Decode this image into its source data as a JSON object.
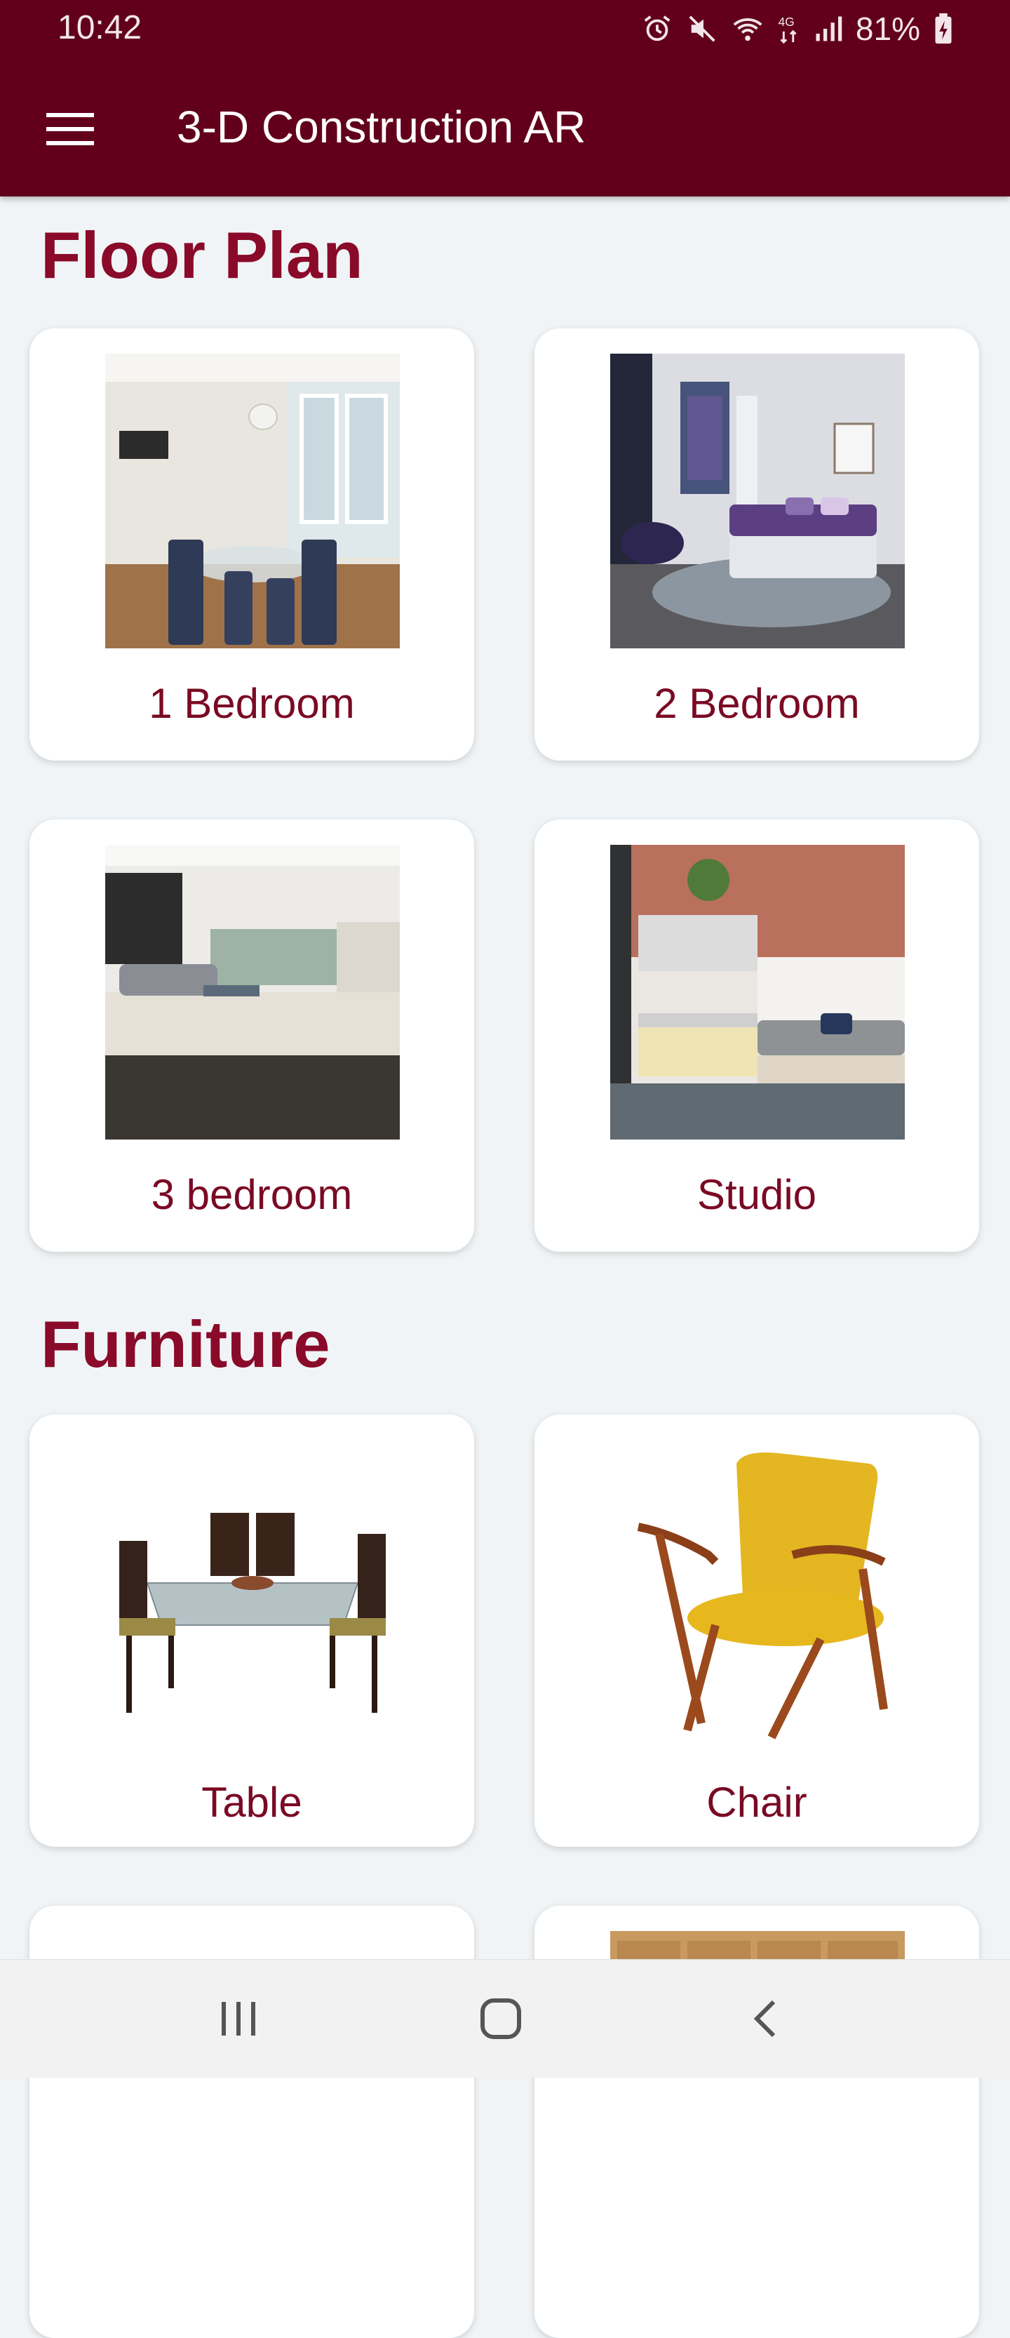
{
  "status_bar": {
    "time": "10:42",
    "battery": "81%",
    "icons": [
      "alarm-icon",
      "mute-icon",
      "wifi-icon",
      "4g-icon",
      "signal-icon",
      "battery-charging-icon"
    ]
  },
  "app_bar": {
    "title": "3-D Construction AR",
    "menu_icon": "hamburger-menu-icon",
    "background": "#62001c"
  },
  "sections": [
    {
      "title": "Floor Plan",
      "items": [
        {
          "label": "1 Bedroom"
        },
        {
          "label": "2 Bedroom"
        },
        {
          "label": "3 bedroom"
        },
        {
          "label": "Studio"
        }
      ]
    },
    {
      "title": "Furniture",
      "items": [
        {
          "label": "Table"
        },
        {
          "label": "Chair"
        }
      ]
    }
  ],
  "colors": {
    "accent": "#8a0a2a",
    "label": "#7a0a24",
    "page_bg": "#f1f4f6"
  },
  "nav_bar": {
    "icons": [
      "recent-apps-icon",
      "home-icon",
      "back-icon"
    ]
  }
}
